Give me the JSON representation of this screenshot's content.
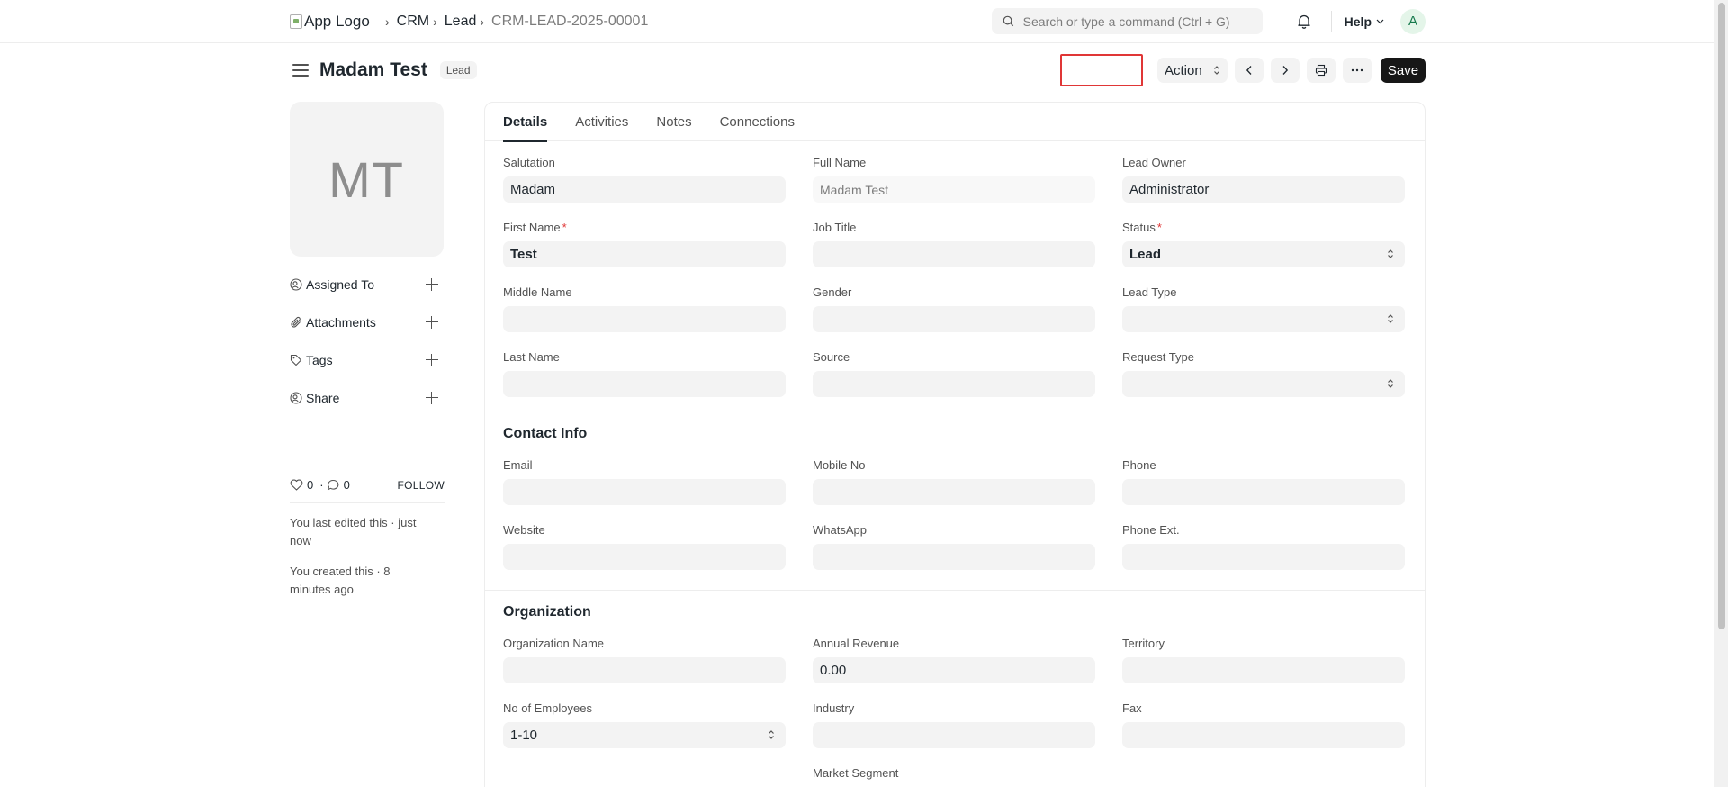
{
  "navbar": {
    "logo_alt": "App Logo",
    "breadcrumbs": [
      "CRM",
      "Lead",
      "CRM-LEAD-2025-00001"
    ],
    "search_placeholder": "Search or type a command (Ctrl + G)",
    "help_label": "Help",
    "avatar_initial": "A"
  },
  "header": {
    "title": "Madam Test",
    "status_indicator": "Lead",
    "action_label": "Action",
    "save_label": "Save"
  },
  "sidebar": {
    "initials": "MT",
    "items": [
      {
        "label": "Assigned To",
        "icon": "user-assign-icon"
      },
      {
        "label": "Attachments",
        "icon": "paperclip-icon"
      },
      {
        "label": "Tags",
        "icon": "tag-icon"
      },
      {
        "label": "Share",
        "icon": "share-user-icon"
      }
    ],
    "likes": "0",
    "comments": "0",
    "follow_label": "FOLLOW",
    "timeline": [
      "You last edited this · just now",
      "You created this · 8 minutes ago"
    ]
  },
  "tabs": [
    "Details",
    "Activities",
    "Notes",
    "Connections"
  ],
  "details": {
    "fields": [
      {
        "label": "Salutation",
        "value": "Madam"
      },
      {
        "label": "Full Name",
        "value": "Madam Test"
      },
      {
        "label": "Lead Owner",
        "value": "Administrator"
      },
      {
        "label": "First Name",
        "value": "Test"
      },
      {
        "label": "Job Title",
        "value": ""
      },
      {
        "label": "Status",
        "value": "Lead"
      },
      {
        "label": "Middle Name",
        "value": ""
      },
      {
        "label": "Gender",
        "value": ""
      },
      {
        "label": "Lead Type",
        "value": ""
      },
      {
        "label": "Last Name",
        "value": ""
      },
      {
        "label": "Source",
        "value": ""
      },
      {
        "label": "Request Type",
        "value": ""
      }
    ]
  },
  "contact": {
    "title": "Contact Info",
    "fields": [
      {
        "label": "Email",
        "value": ""
      },
      {
        "label": "Mobile No",
        "value": ""
      },
      {
        "label": "Phone",
        "value": ""
      },
      {
        "label": "Website",
        "value": ""
      },
      {
        "label": "WhatsApp",
        "value": ""
      },
      {
        "label": "Phone Ext.",
        "value": ""
      }
    ]
  },
  "organization": {
    "title": "Organization",
    "fields": [
      {
        "label": "Organization Name",
        "value": ""
      },
      {
        "label": "Annual Revenue",
        "value": "0.00"
      },
      {
        "label": "Territory",
        "value": ""
      },
      {
        "label": "No of Employees",
        "value": "1-10"
      },
      {
        "label": "Industry",
        "value": ""
      },
      {
        "label": "Fax",
        "value": ""
      },
      {
        "label": "Market Segment",
        "value": ""
      }
    ]
  },
  "colors": {
    "accent": "#171717",
    "required": "#e03636",
    "field_bg": "#f3f3f3"
  }
}
